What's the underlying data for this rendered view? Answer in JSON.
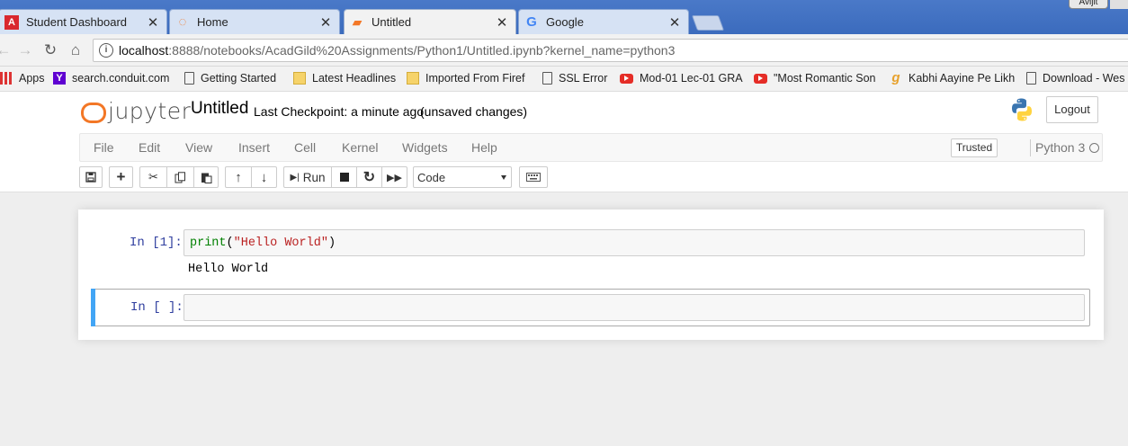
{
  "browser": {
    "tabs": [
      {
        "title": "Student Dashboard",
        "icon": "acadgild-icon"
      },
      {
        "title": "Home",
        "icon": "jupyter-icon"
      },
      {
        "title": "Untitled",
        "icon": "notebook-icon",
        "active": true
      },
      {
        "title": "Google",
        "icon": "google-icon"
      }
    ],
    "user_badge": "Avijit",
    "address": {
      "host": "localhost",
      "path": ":8888/notebooks/AcadGild%20Assignments/Python1/Untitled.ipynb?kernel_name=python3"
    },
    "bookmarks": [
      {
        "label": "Apps",
        "icon": "apps-icon"
      },
      {
        "label": "search.conduit.com",
        "icon": "yahoo-icon"
      },
      {
        "label": "Getting Started",
        "icon": "page-icon"
      },
      {
        "label": "Latest Headlines",
        "icon": "folder-icon"
      },
      {
        "label": "Imported From Firef",
        "icon": "folder-icon"
      },
      {
        "label": "SSL Error",
        "icon": "page-icon"
      },
      {
        "label": "Mod-01 Lec-01 GRA",
        "icon": "youtube-icon"
      },
      {
        "label": "\"Most Romantic Son",
        "icon": "youtube-icon"
      },
      {
        "label": "Kabhi Aayine Pe Likh",
        "icon": "gaana-icon"
      },
      {
        "label": "Download - Wes",
        "icon": "page-icon"
      }
    ]
  },
  "jupyter": {
    "logo_text": "jupyter",
    "notebook_name": "Untitled",
    "checkpoint": "Last Checkpoint: a minute ago",
    "autosave": "(unsaved changes)",
    "logout": "Logout",
    "menu": [
      "File",
      "Edit",
      "View",
      "Insert",
      "Cell",
      "Kernel",
      "Widgets",
      "Help"
    ],
    "trusted": "Trusted",
    "kernel_name": "Python 3",
    "toolbar": {
      "run_label": "Run",
      "cell_type": "Code"
    },
    "cells": [
      {
        "prompt": "In [1]:",
        "code": {
          "func": "print",
          "open": "(",
          "string": "\"Hello World\"",
          "close": ")"
        },
        "output": "Hello World"
      },
      {
        "prompt": "In [ ]:",
        "code": ""
      }
    ]
  }
}
